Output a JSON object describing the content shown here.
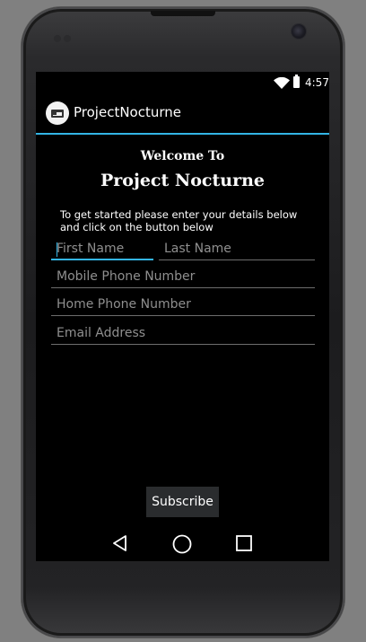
{
  "status_bar": {
    "time": "4:57",
    "icons": [
      "wifi-icon",
      "battery-icon"
    ]
  },
  "action_bar": {
    "icon": "app-bed-icon",
    "title": "ProjectNocturne",
    "accent_color": "#33b5e5"
  },
  "main": {
    "welcome": "Welcome To",
    "brand": "Project Nocturne",
    "intro": "To get started please enter your details below and click on the button below",
    "fields": {
      "first_name": {
        "placeholder": "First Name",
        "value": "",
        "focused": true
      },
      "last_name": {
        "placeholder": "Last Name",
        "value": ""
      },
      "mobile_phone": {
        "placeholder": "Mobile Phone Number",
        "value": ""
      },
      "home_phone": {
        "placeholder": "Home Phone Number",
        "value": ""
      },
      "email": {
        "placeholder": "Email Address",
        "value": ""
      }
    },
    "subscribe_label": "Subscribe"
  },
  "nav_bar": {
    "icons": [
      "back-icon",
      "home-icon",
      "recent-apps-icon"
    ]
  }
}
